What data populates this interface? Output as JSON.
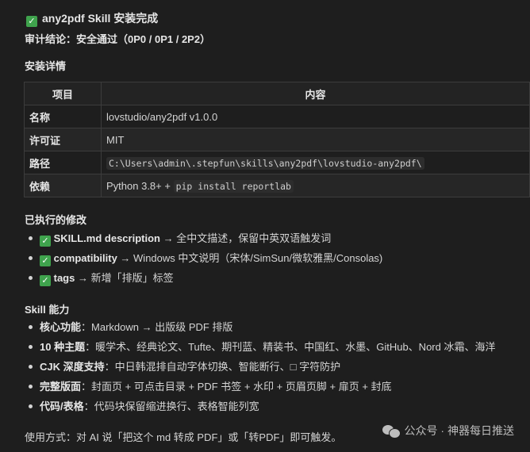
{
  "header": {
    "title": "any2pdf Skill 安装完成",
    "verdict_label": "审计结论：",
    "verdict_value": "安全通过（0P0 / 0P1 / 2P2）"
  },
  "install_details": {
    "heading": "安装详情",
    "col_item": "项目",
    "col_content": "内容",
    "rows": [
      {
        "k": "名称",
        "v": "lovstudio/any2pdf v1.0.0"
      },
      {
        "k": "许可证",
        "v": "MIT"
      },
      {
        "k": "路径",
        "code": "C:\\Users\\admin\\.stepfun\\skills\\any2pdf\\lovstudio-any2pdf\\"
      },
      {
        "k": "依赖",
        "v": "Python 3.8+ + ",
        "code": "pip install reportlab"
      }
    ]
  },
  "changes": {
    "heading": "已执行的修改",
    "items": [
      {
        "b": "SKILL.md description",
        "t": " → 全中文描述，保留中英双语触发词"
      },
      {
        "b": "compatibility",
        "t": " → Windows 中文说明（宋体/SimSun/微软雅黑/Consolas)"
      },
      {
        "b": "tags",
        "t": " → 新增「排版」标签"
      }
    ]
  },
  "abilities": {
    "heading": "Skill 能力",
    "items": [
      {
        "b": "核心功能",
        "t": "：Markdown → 出版级 PDF 排版"
      },
      {
        "b": "10 种主题",
        "t": "：暖学术、经典论文、Tufte、期刊蓝、精装书、中国红、水墨、GitHub、Nord 冰霜、海洋"
      },
      {
        "b": "CJK 深度支持",
        "t": "：中日韩混排自动字体切换、智能断行、□ 字符防护"
      },
      {
        "b": "完整版面",
        "t": "：封面页 + 可点击目录 + PDF 书签 + 水印 + 页眉页脚 + 扉页 + 封底"
      },
      {
        "b": "代码/表格",
        "t": "：代码块保留缩进换行、表格智能列宽"
      }
    ]
  },
  "usage": "使用方式：对 AI 说「把这个 md 转成 PDF」或「转PDF」即可触发。",
  "watermark": "公众号 · 神器每日推送",
  "icons": {
    "check": "check-box-icon",
    "wechat": "wechat-icon"
  },
  "colors": {
    "check_green": "#3fa34d",
    "background": "#1e1e1e"
  }
}
